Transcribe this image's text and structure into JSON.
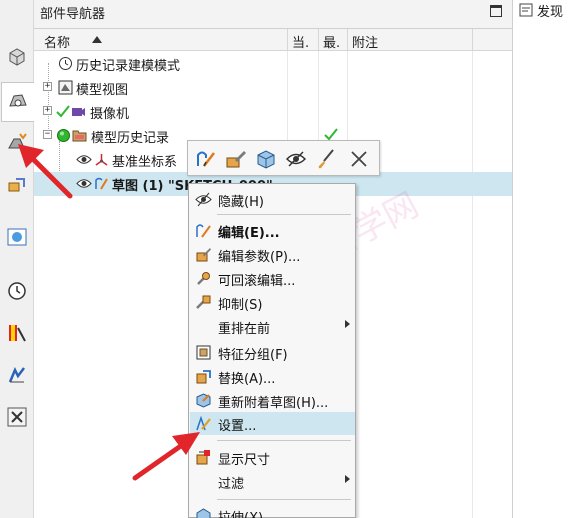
{
  "navigator": {
    "title": "部件导航器",
    "columns": {
      "name": "名称",
      "current": "当.",
      "latest": "最.",
      "comment": "附注"
    },
    "rows": [
      {
        "label": "历史记录建模模式"
      },
      {
        "label": "模型视图"
      },
      {
        "label": "摄像机"
      },
      {
        "label": "模型历史记录"
      },
      {
        "label": "基准坐标系"
      },
      {
        "label": "草图 (1) \"SKETCH_000\""
      }
    ]
  },
  "right_panel": {
    "tab_label": "发现"
  },
  "mini_toolbar": {
    "items": [
      {
        "icon": "edit-sketch-icon"
      },
      {
        "icon": "edit-parameters-icon"
      },
      {
        "icon": "solid-body-icon"
      },
      {
        "icon": "hide-eye-icon"
      },
      {
        "icon": "brush-icon"
      },
      {
        "icon": "delete-x-icon"
      }
    ]
  },
  "context_menu": {
    "items": [
      {
        "label": "隐藏(H)",
        "icon": "hide-icon"
      },
      {
        "label": "编辑(E)...",
        "icon": "edit-sketch-icon"
      },
      {
        "label": "编辑参数(P)...",
        "icon": "edit-parameters-icon"
      },
      {
        "label": "可回滚编辑...",
        "icon": "rollback-edit-icon"
      },
      {
        "label": "抑制(S)",
        "icon": "suppress-icon"
      },
      {
        "label": "重排在前",
        "icon": ""
      },
      {
        "label": "特征分组(F)",
        "icon": "feature-group-icon"
      },
      {
        "label": "替换(A)...",
        "icon": "replace-icon"
      },
      {
        "label": "重新附着草图(H)...",
        "icon": "reattach-sketch-icon"
      },
      {
        "label": "设置...",
        "icon": "settings-pencil-icon"
      },
      {
        "label": "显示尺寸",
        "icon": "show-dimensions-icon"
      },
      {
        "label": "过滤",
        "icon": ""
      },
      {
        "label": "拉伸(X)...",
        "icon": "extrude-icon"
      }
    ]
  },
  "watermark": "软件自学网",
  "colors": {
    "selection": "#cde6f0",
    "check_green": "#2fb82f",
    "arrow_red": "#e0262a"
  }
}
